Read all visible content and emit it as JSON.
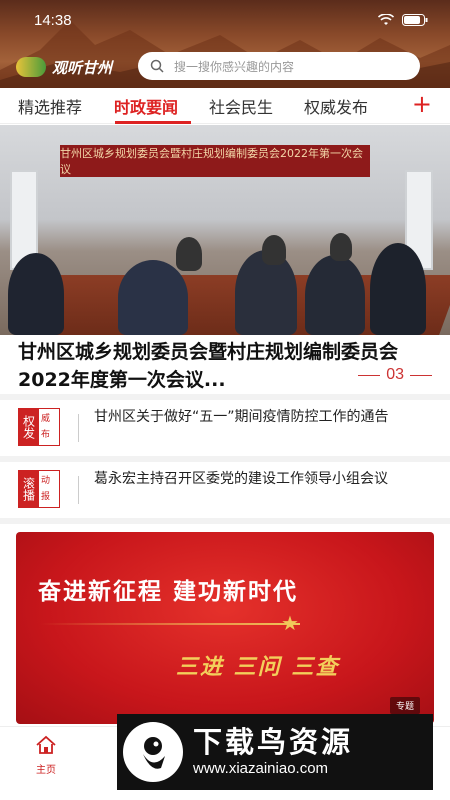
{
  "status": {
    "time": "14:38"
  },
  "header": {
    "app_name": "观听甘州",
    "search_placeholder": "搜一搜你感兴趣的内容"
  },
  "tabs": [
    {
      "label": "精选推荐",
      "active": false
    },
    {
      "label": "时政要闻",
      "active": true
    },
    {
      "label": "社会民生",
      "active": false
    },
    {
      "label": "权威发布",
      "active": false
    }
  ],
  "tab_add": "+",
  "hero": {
    "banner_text": "甘州区城乡规划委员会暨村庄规划编制委员会2022年第一次会议",
    "headline": "甘州区城乡规划委员会暨村庄规划编制委员会2022年度第一次会议...",
    "counter": "03"
  },
  "news": [
    {
      "badge_main": "权发",
      "badge_top": "威",
      "badge_bottom": "布",
      "text": "甘州区关于做好“五一”期间疫情防控工作的通告"
    },
    {
      "badge_main": "滚播",
      "badge_top": "动",
      "badge_bottom": "报",
      "text": "葛永宏主持召开区委党的建设工作领导小组会议"
    }
  ],
  "promo": {
    "title": "奋进新征程  建功新时代",
    "subtitle": "三进 三问 三查",
    "tag": "专题"
  },
  "bottom_nav": {
    "home_label": "主页"
  },
  "watermark": {
    "title": "下载鸟资源",
    "url": "www.xiazainiao.com"
  },
  "colors": {
    "accent": "#d22222",
    "promo": "#c8161b",
    "gold": "#f0c85a"
  }
}
